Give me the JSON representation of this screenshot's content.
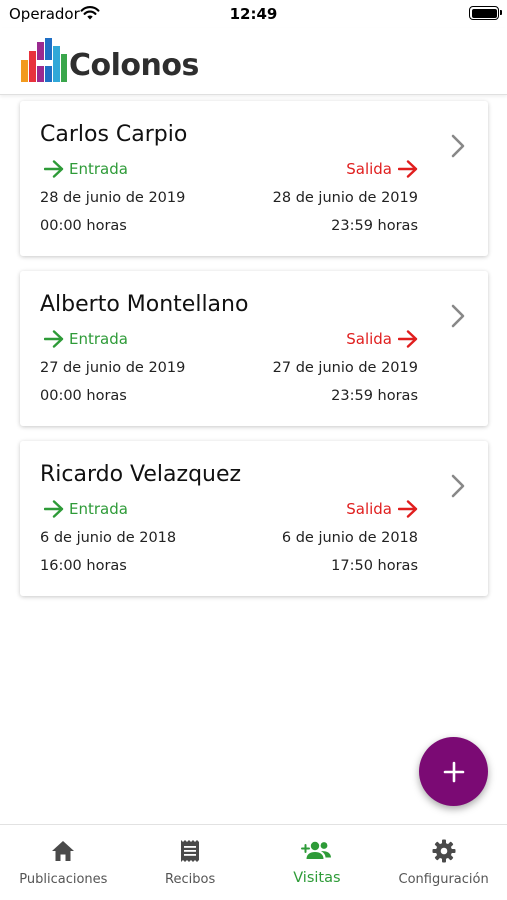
{
  "status_bar": {
    "carrier": "Operador",
    "time": "12:49"
  },
  "header": {
    "brand": "Colonos"
  },
  "visits": [
    {
      "name": "Carlos Carpio",
      "entry_label": "Entrada",
      "exit_label": "Salida",
      "entry_date": "28 de junio de 2019",
      "exit_date": "28 de junio de 2019",
      "entry_time": "00:00 horas",
      "exit_time": "23:59 horas"
    },
    {
      "name": "Alberto Montellano",
      "entry_label": "Entrada",
      "exit_label": "Salida",
      "entry_date": "27 de junio de 2019",
      "exit_date": "27 de junio de 2019",
      "entry_time": "00:00 horas",
      "exit_time": "23:59 horas"
    },
    {
      "name": "Ricardo Velazquez",
      "entry_label": "Entrada",
      "exit_label": "Salida",
      "entry_date": "6 de junio de 2018",
      "exit_date": "6 de junio de 2018",
      "entry_time": "16:00 horas",
      "exit_time": "17:50 horas"
    }
  ],
  "fab": {
    "icon": "plus-icon"
  },
  "tabs": [
    {
      "label": "Publicaciones",
      "icon": "home-icon",
      "active": false
    },
    {
      "label": "Recibos",
      "icon": "receipt-icon",
      "active": false
    },
    {
      "label": "Visitas",
      "icon": "people-add-icon",
      "active": true
    },
    {
      "label": "Configuración",
      "icon": "gear-icon",
      "active": false
    }
  ],
  "colors": {
    "entry": "#2e9b38",
    "exit": "#e01e1e",
    "fab": "#7b0a74",
    "active_tab": "#2e9b38"
  }
}
